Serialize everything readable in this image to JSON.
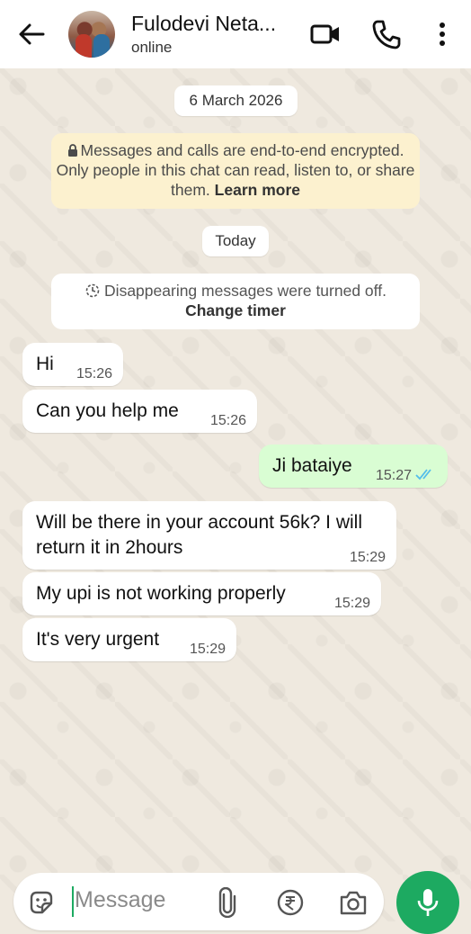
{
  "header": {
    "contact_name": "Fulodevi Neta...",
    "status": "online"
  },
  "chat": {
    "date_chip": "6 March 2026",
    "encryption_text": "Messages and calls are end-to-end encrypted. Only people in this chat can read, listen to, or share them.",
    "learn_more": "Learn more",
    "today_chip": "Today",
    "disappearing_text": "Disappearing messages were turned off.",
    "change_timer": "Change timer",
    "messages": [
      {
        "direction": "in",
        "text": "Hi",
        "time": "15:26"
      },
      {
        "direction": "in",
        "text": "Can you help me",
        "time": "15:26"
      },
      {
        "direction": "out",
        "text": "Ji bataiye",
        "time": "15:27",
        "status": "read"
      },
      {
        "direction": "in",
        "text": "Will be there in your account 56k? I will return it in 2hours",
        "time": "15:29"
      },
      {
        "direction": "in",
        "text": "My upi is not working properly",
        "time": "15:29"
      },
      {
        "direction": "in",
        "text": "It's very urgent",
        "time": "15:29"
      }
    ]
  },
  "composer": {
    "placeholder": "Message"
  },
  "colors": {
    "accent": "#1daa61",
    "outgoing_bubble": "#d9fdd3",
    "incoming_bubble": "#ffffff",
    "chat_background": "#efe9df",
    "encryption_notice": "#fcf1cf",
    "read_ticks": "#53bdeb"
  }
}
